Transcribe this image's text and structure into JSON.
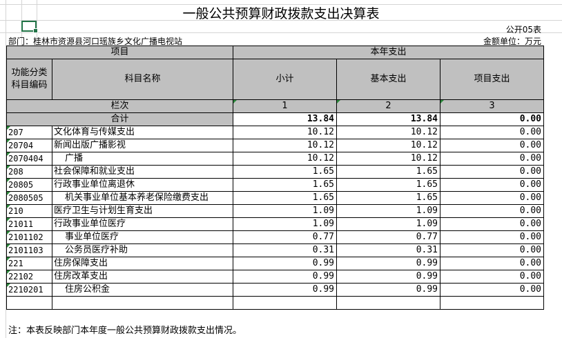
{
  "title": "一般公共预算财政拨款支出决算表",
  "form_no": "公开05表",
  "department": "部门：桂林市资源县河口瑶族乡文化广播电视站",
  "unit": "金额单位：万元",
  "headers": {
    "item": "项目",
    "current_year": "本年支出",
    "func_code": "功能分类\n科目编码",
    "subject_name": "科目名称",
    "subtotal": "小计",
    "basic": "基本支出",
    "project": "项目支出",
    "column_order": "栏次",
    "col1": "1",
    "col2": "2",
    "col3": "3",
    "total": "合计"
  },
  "totals": {
    "subtotal": "13.84",
    "basic": "13.84",
    "project": "0.00"
  },
  "rows": [
    {
      "code": "207",
      "name": "文化体育与传媒支出",
      "subtotal": "10.12",
      "basic": "10.12",
      "project": "0.00"
    },
    {
      "code": "20704",
      "name": "新闻出版广播影视",
      "subtotal": "10.12",
      "basic": "10.12",
      "project": "0.00"
    },
    {
      "code": "2070404",
      "name": "广播",
      "subtotal": "10.12",
      "basic": "10.12",
      "project": "0.00"
    },
    {
      "code": "208",
      "name": "社会保障和就业支出",
      "subtotal": "1.65",
      "basic": "1.65",
      "project": "0.00"
    },
    {
      "code": "20805",
      "name": "行政事业单位离退休",
      "subtotal": "1.65",
      "basic": "1.65",
      "project": "0.00"
    },
    {
      "code": "2080505",
      "name": "机关事业单位基本养老保险缴费支出",
      "subtotal": "1.65",
      "basic": "1.65",
      "project": "0.00"
    },
    {
      "code": "210",
      "name": "医疗卫生与计划生育支出",
      "subtotal": "1.09",
      "basic": "1.09",
      "project": "0.00"
    },
    {
      "code": "21011",
      "name": "行政事业单位医疗",
      "subtotal": "1.09",
      "basic": "1.09",
      "project": "0.00"
    },
    {
      "code": "2101102",
      "name": "事业单位医疗",
      "subtotal": "0.77",
      "basic": "0.77",
      "project": "0.00"
    },
    {
      "code": "2101103",
      "name": "公务员医疗补助",
      "subtotal": "0.31",
      "basic": "0.31",
      "project": "0.00"
    },
    {
      "code": "221",
      "name": "住房保障支出",
      "subtotal": "0.99",
      "basic": "0.99",
      "project": "0.00"
    },
    {
      "code": "22102",
      "name": "住房改革支出",
      "subtotal": "0.99",
      "basic": "0.99",
      "project": "0.00"
    },
    {
      "code": "2210201",
      "name": "住房公积金",
      "subtotal": "0.99",
      "basic": "0.99",
      "project": "0.00"
    }
  ],
  "note": "注：本表反映部门本年度一般公共预算财政拨款支出情况。"
}
